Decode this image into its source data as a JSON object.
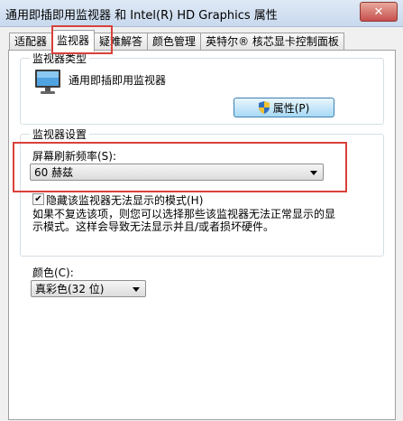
{
  "window": {
    "title": "通用即插即用监视器 和 Intel(R) HD Graphics 属性",
    "close_label": "✕"
  },
  "tabs": [
    {
      "label": "适配器",
      "active": false
    },
    {
      "label": "监视器",
      "active": true
    },
    {
      "label": "疑难解答",
      "active": false
    },
    {
      "label": "颜色管理",
      "active": false
    },
    {
      "label": "英特尔® 核芯显卡控制面板",
      "active": false
    }
  ],
  "monitor_type": {
    "group_title": "监视器类型",
    "monitor_name": "通用即插即用监视器",
    "properties_button": "属性(P)"
  },
  "monitor_settings": {
    "group_title": "监视器设置",
    "refresh_label": "屏幕刷新频率(S):",
    "refresh_value": "60 赫兹",
    "hide_modes_label": "隐藏该监视器无法显示的模式(H)",
    "hide_modes_checked": true,
    "description": "如果不复选该项，则您可以选择那些该监视器无法正常显示的显示模式。这样会导致无法显示并且/或者损坏硬件。"
  },
  "color": {
    "label": "颜色(C):",
    "value": "真彩色(32 位)"
  },
  "colors": {
    "highlight": "#d9413b"
  }
}
